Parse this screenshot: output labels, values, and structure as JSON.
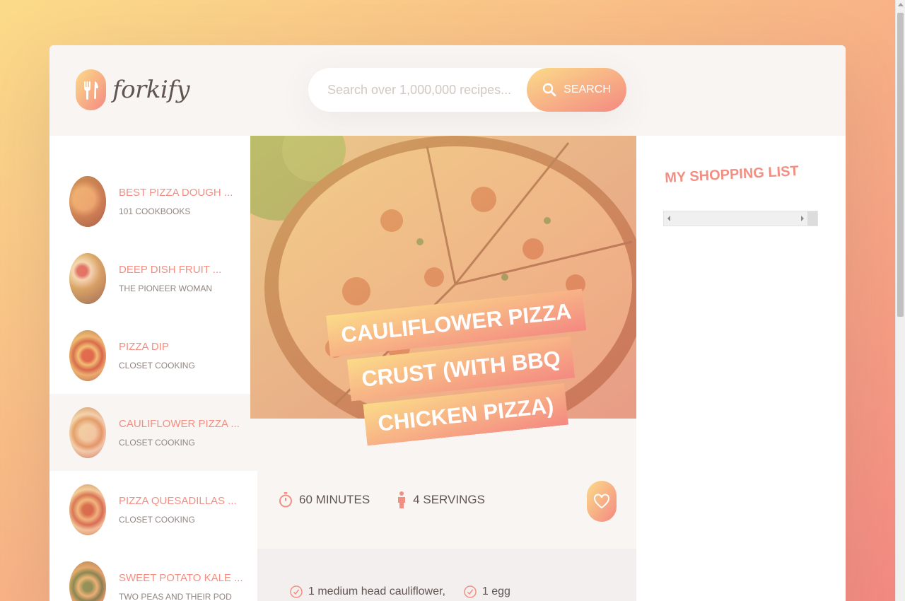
{
  "brand": {
    "name": "forkify"
  },
  "search": {
    "placeholder": "Search over 1,000,000 recipes...",
    "button_label": "SEARCH"
  },
  "results": [
    {
      "title": "BEST PIZZA DOUGH ...",
      "author": "101 COOKBOOKS",
      "active": false
    },
    {
      "title": "DEEP DISH FRUIT ...",
      "author": "THE PIONEER WOMAN",
      "active": false
    },
    {
      "title": "PIZZA DIP",
      "author": "CLOSET COOKING",
      "active": false
    },
    {
      "title": "CAULIFLOWER PIZZA ...",
      "author": "CLOSET COOKING",
      "active": true
    },
    {
      "title": "PIZZA QUESADILLAS ...",
      "author": "CLOSET COOKING",
      "active": false
    },
    {
      "title": "SWEET POTATO KALE ...",
      "author": "TWO PEAS AND THEIR POD",
      "active": false
    }
  ],
  "recipe": {
    "title": "CAULIFLOWER PIZZA CRUST (WITH BBQ CHICKEN PIZZA)",
    "time_value": "60",
    "time_unit": "MINUTES",
    "servings_value": "4",
    "servings_unit": "SERVINGS",
    "ingredients": [
      "1 medium head cauliflower,",
      "1 egg"
    ]
  },
  "shopping": {
    "title": "MY SHOPPING LIST"
  },
  "colors": {
    "accent_from": "#fbdb89",
    "accent_to": "#f48982",
    "text": "#615551",
    "highlight": "#f38e82"
  },
  "icons": [
    "fork-knife-icon",
    "search-icon",
    "stopwatch-icon",
    "person-icon",
    "heart-icon",
    "check-circle-icon"
  ]
}
